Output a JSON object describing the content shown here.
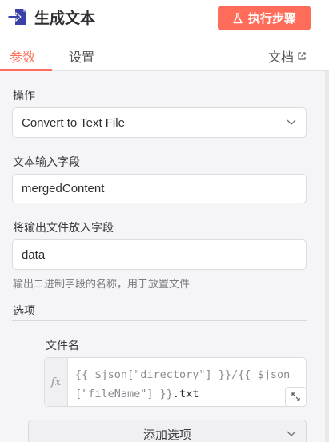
{
  "header": {
    "title": "生成文本",
    "execute_label": "执行步骤",
    "accent_color": "#ff6d5a",
    "node_icon": "file-arrow-icon",
    "flask_icon": "flask-icon"
  },
  "tabs": {
    "items": [
      {
        "label": "参数",
        "active": true
      },
      {
        "label": "设置",
        "active": false
      }
    ],
    "docs_label": "文档",
    "docs_icon": "external-link-icon"
  },
  "form": {
    "operation_label": "操作",
    "operation_value": "Convert to Text File",
    "text_input_label": "文本输入字段",
    "text_input_value": "mergedContent",
    "output_label": "将输出文件放入字段",
    "output_value": "data",
    "output_hint": "输出二进制字段的名称，用于放置文件",
    "options_title": "选项",
    "filename_label": "文件名",
    "filename_fx": "fx",
    "filename_expr_part1": "{{ $json[\"directory\"] }}/{{ $json[\"fileName\"] }}",
    "filename_expr_part2": ".txt",
    "add_option_label": "添加选项"
  }
}
